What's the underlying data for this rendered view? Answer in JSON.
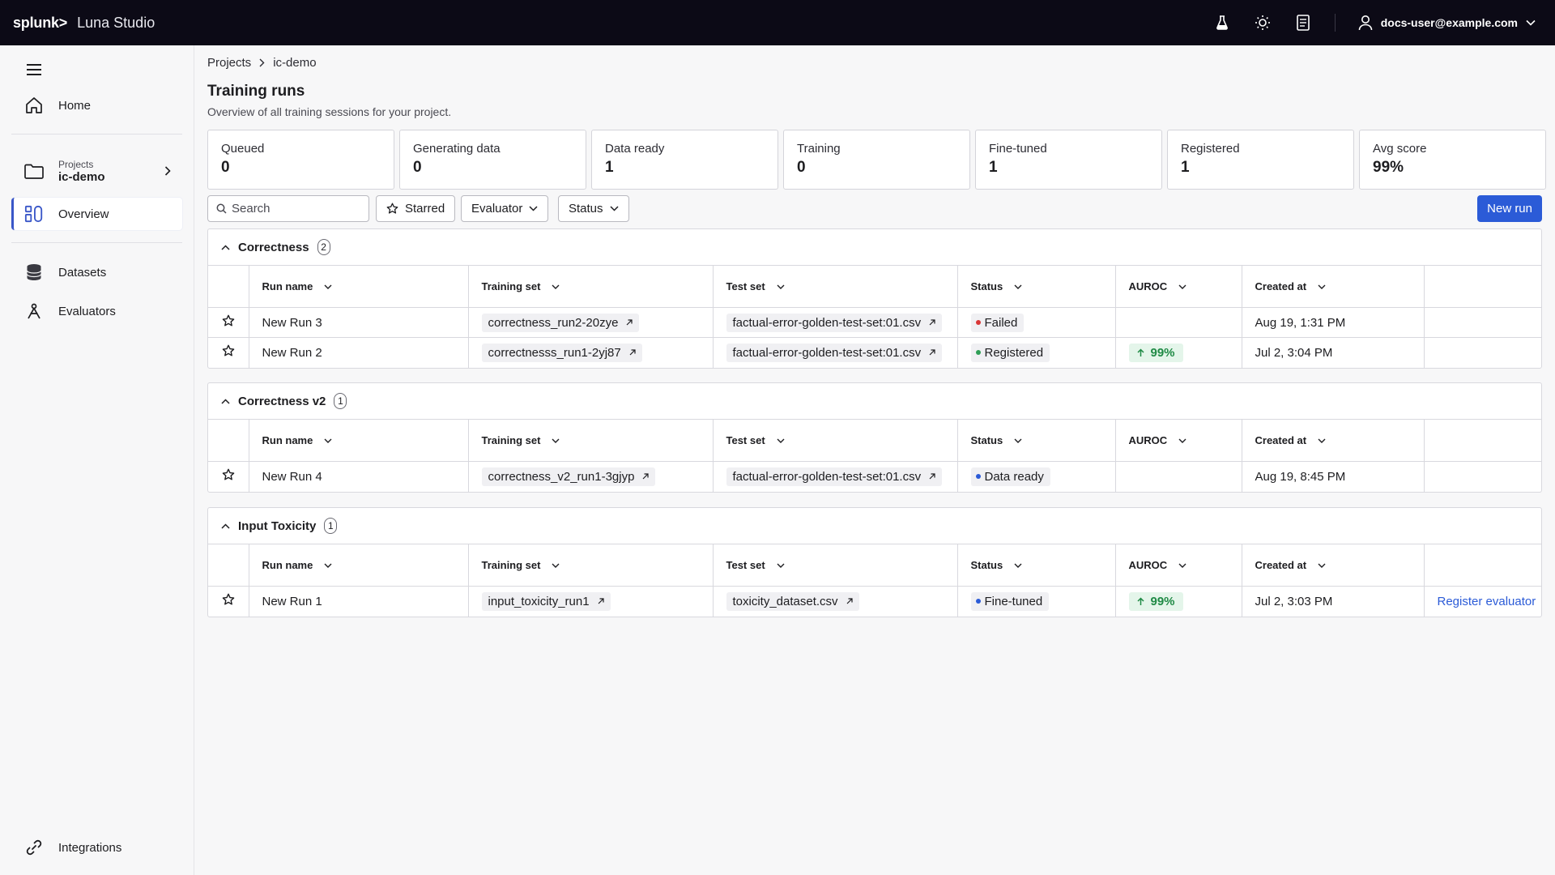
{
  "header": {
    "brand": "splunk>",
    "app_name": "Luna Studio",
    "user_email": "docs-user@example.com",
    "icons": [
      "flask-icon",
      "sun-icon",
      "document-icon",
      "user-icon"
    ]
  },
  "sidebar": {
    "home": "Home",
    "project_label": "Projects",
    "project_name": "ic-demo",
    "overview": "Overview",
    "datasets": "Datasets",
    "evaluators": "Evaluators",
    "integrations": "Integrations"
  },
  "breadcrumb": {
    "root": "Projects",
    "current": "ic-demo"
  },
  "page": {
    "title": "Training runs",
    "subtitle": "Overview of all training sessions for your project."
  },
  "stats": [
    {
      "label": "Queued",
      "value": "0"
    },
    {
      "label": "Generating data",
      "value": "0"
    },
    {
      "label": "Data ready",
      "value": "1"
    },
    {
      "label": "Training",
      "value": "0"
    },
    {
      "label": "Fine-tuned",
      "value": "1"
    },
    {
      "label": "Registered",
      "value": "1"
    },
    {
      "label": "Avg score",
      "value": "99%"
    }
  ],
  "toolbar": {
    "search_placeholder": "Search",
    "starred": "Starred",
    "evaluator": "Evaluator",
    "status": "Status",
    "new_run": "New run"
  },
  "columns": {
    "run_name": "Run name",
    "training_set": "Training set",
    "test_set": "Test set",
    "status": "Status",
    "auroc": "AUROC",
    "created_at": "Created at"
  },
  "groups": [
    {
      "name": "Correctness",
      "count": "2",
      "rows": [
        {
          "run": "New Run 3",
          "training": "correctness_run2-20zye",
          "test": "factual-error-golden-test-set:01.csv",
          "status": "Failed",
          "status_color": "#d93636",
          "auroc": "",
          "created": "Aug 19, 1:31 PM",
          "action": ""
        },
        {
          "run": "New Run 2",
          "training": "correctnesss_run1-2yj87",
          "test": "factual-error-golden-test-set:01.csv",
          "status": "Registered",
          "status_color": "#2f9e56",
          "auroc": "99%",
          "created": "Jul 2, 3:04 PM",
          "action": ""
        }
      ]
    },
    {
      "name": "Correctness v2",
      "count": "1",
      "rows": [
        {
          "run": "New Run 4",
          "training": "correctness_v2_run1-3gjyp",
          "test": "factual-error-golden-test-set:01.csv",
          "status": "Data ready",
          "status_color": "#2b5bd7",
          "auroc": "",
          "created": "Aug 19, 8:45 PM",
          "action": ""
        }
      ]
    },
    {
      "name": "Input Toxicity",
      "count": "1",
      "rows": [
        {
          "run": "New Run 1",
          "training": "input_toxicity_run1",
          "test": "toxicity_dataset.csv",
          "status": "Fine-tuned",
          "status_color": "#2b5bd7",
          "auroc": "99%",
          "created": "Jul 2, 3:03 PM",
          "action": "Register evaluator"
        }
      ]
    }
  ]
}
